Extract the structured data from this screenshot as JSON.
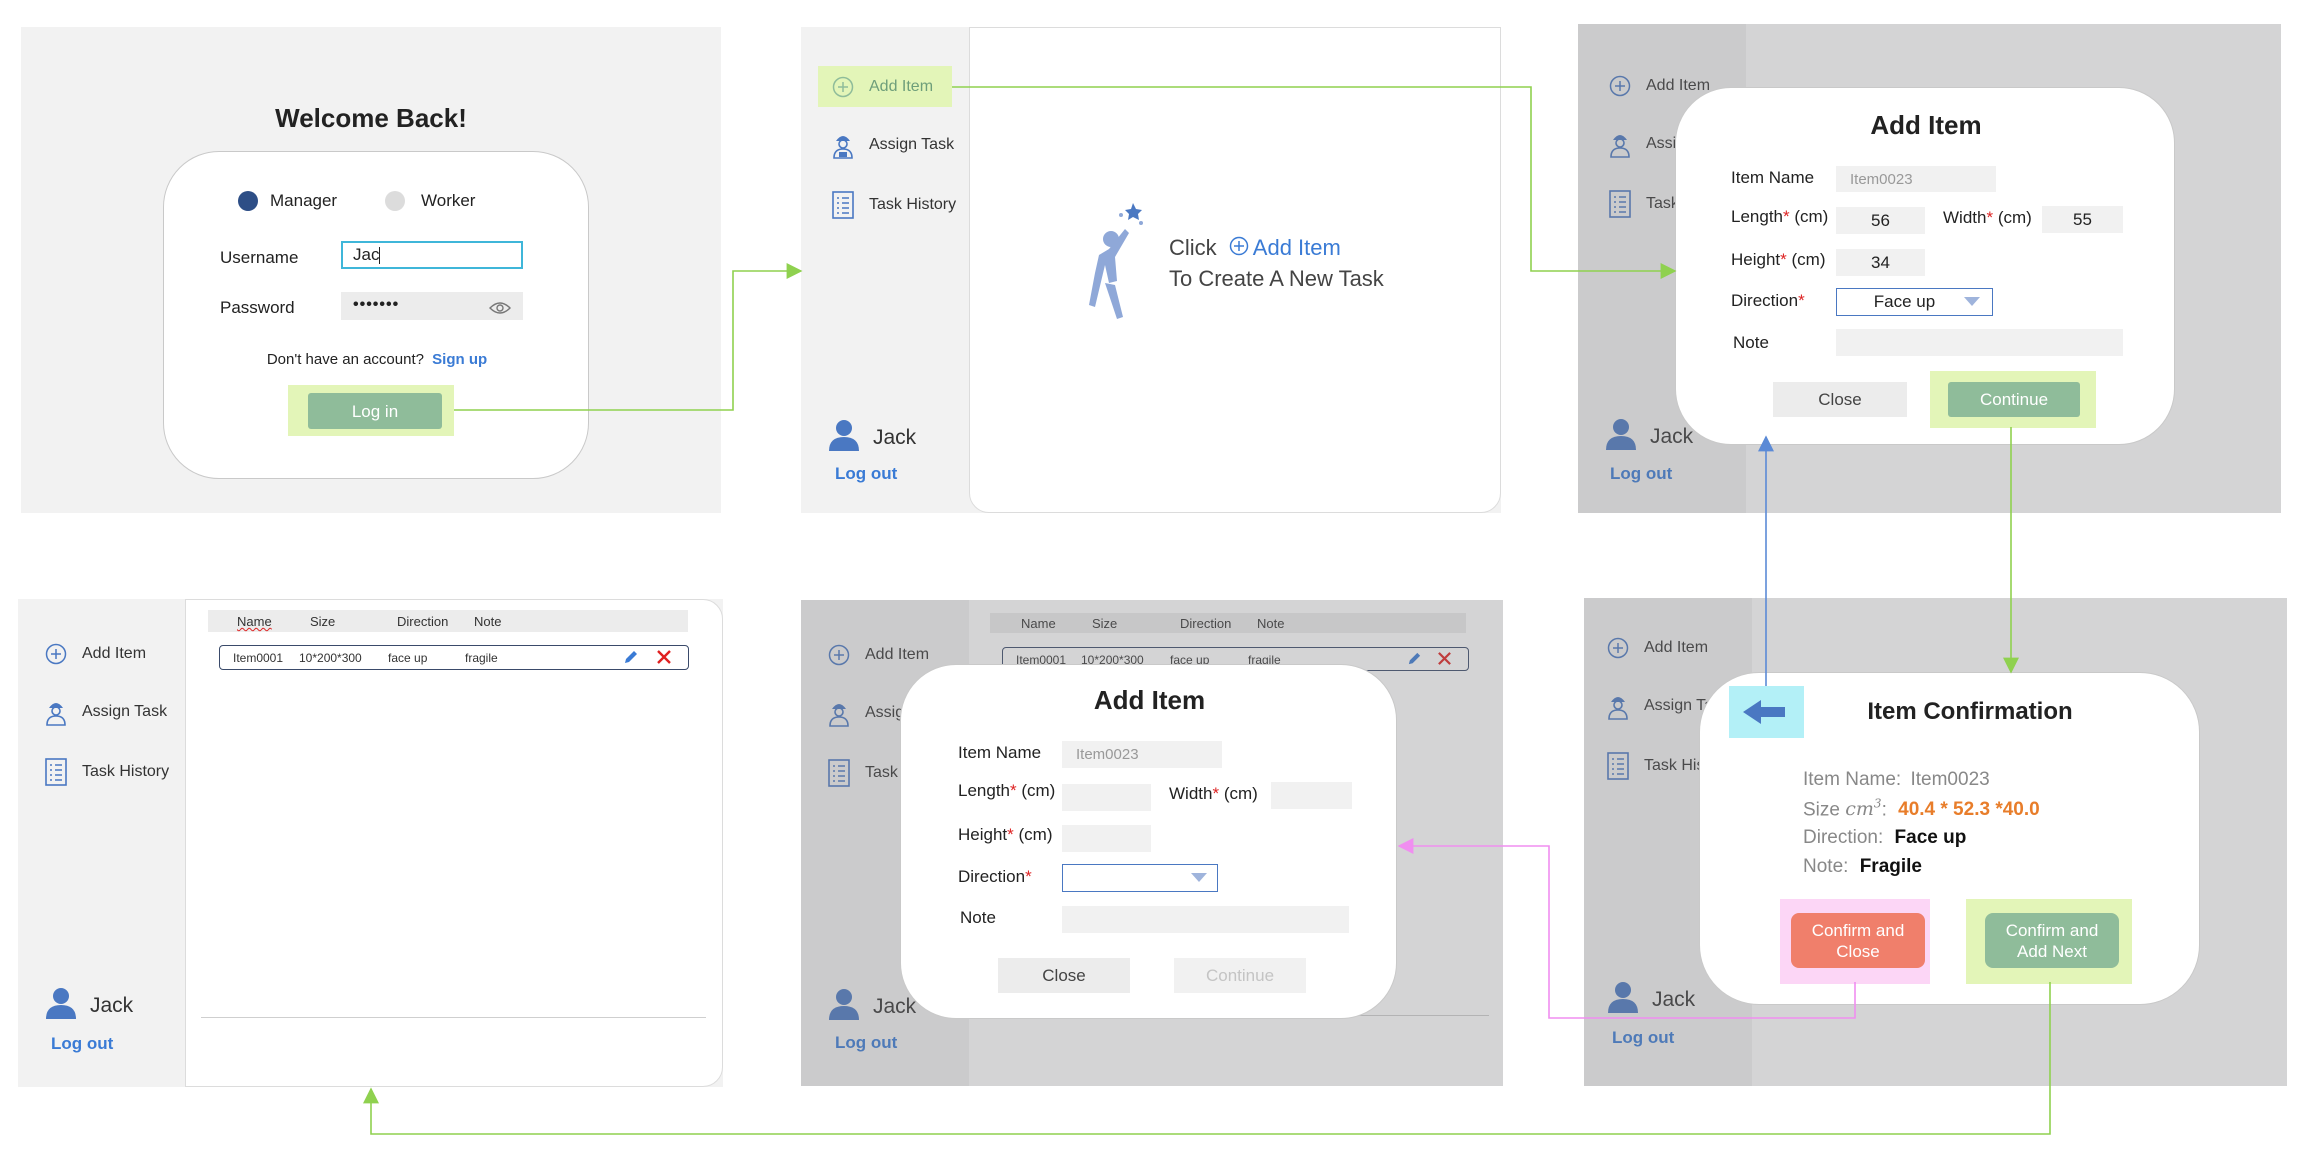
{
  "colors": {
    "accent_green": "#8fbc9a",
    "highlight_green": "#e3f5b8",
    "link_blue": "#3a7bd5",
    "confirm_close_red": "#f07f6b",
    "orange_value": "#e87d2a",
    "required_red": "#d22222",
    "arrow_green": "#8fd14f",
    "arrow_blue": "#5b8ad6",
    "arrow_pink": "#f08ef0"
  },
  "login": {
    "title": "Welcome Back!",
    "role_manager": "Manager",
    "role_worker": "Worker",
    "selected_role": "Manager",
    "username_label": "Username",
    "username_value": "Jac",
    "password_label": "Password",
    "password_value": "•••••••",
    "no_account_text": "Don't have an account?",
    "signup_link": "Sign up",
    "login_button": "Log in"
  },
  "sidebar": {
    "add_item": "Add Item",
    "assign_task": "Assign Task",
    "task_history": "Task History",
    "assign_task_truncated": "Assign Ta",
    "task_history_truncated": "Task Hist",
    "user_name": "Jack",
    "logout": "Log out"
  },
  "empty_state": {
    "click_word": "Click",
    "add_item_link": "Add Item",
    "subtitle": "To Create A New Task"
  },
  "add_item_filled": {
    "title": "Add Item",
    "item_name_label": "Item Name",
    "item_name_value": "Item0023",
    "length_label": "Length",
    "length_value": "56",
    "width_label": "Width",
    "width_value": "55",
    "height_label": "Height",
    "height_value": "34",
    "unit": "(cm)",
    "required_mark": "*",
    "direction_label": "Direction",
    "direction_value": "Face up",
    "note_label": "Note",
    "note_value": "",
    "close_button": "Close",
    "continue_button": "Continue"
  },
  "add_item_empty": {
    "title": "Add Item",
    "item_name_label": "Item Name",
    "item_name_placeholder": "Item0023",
    "length_label": "Length",
    "width_label": "Width",
    "height_label": "Height",
    "unit": "(cm)",
    "required_mark": "*",
    "direction_label": "Direction",
    "note_label": "Note",
    "close_button": "Close",
    "continue_button": "Continue"
  },
  "confirmation": {
    "title": "Item Confirmation",
    "item_name_label": "Item Name:",
    "item_name_value": "Item0023",
    "size_label": "Size",
    "size_unit": "cm",
    "size_unit_exp": "3",
    "size_colon": ":",
    "size_value": "40.4 * 52.3 *40.0",
    "direction_label": "Direction:",
    "direction_value": "Face up",
    "note_label": "Note:",
    "note_value": "Fragile",
    "confirm_close_button": "Confirm and Close",
    "confirm_next_button": "Confirm and Add Next"
  },
  "table": {
    "columns": [
      "Name",
      "Size",
      "Direction",
      "Note"
    ],
    "rows": [
      {
        "name": "Item0001",
        "size": "10*200*300",
        "direction": "face up",
        "note": "fragile"
      }
    ]
  }
}
